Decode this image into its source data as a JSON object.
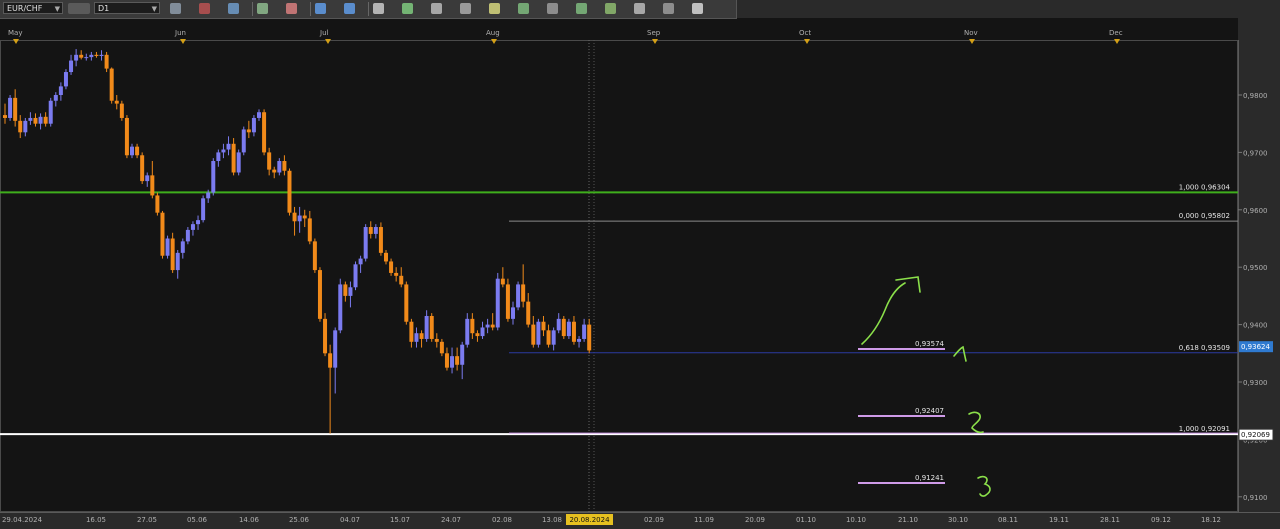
{
  "toolbar": {
    "symbol": "EUR/CHF",
    "timeframe": "D1",
    "tools": [
      "chart-type-icon",
      "crosshair-icon",
      "indicators-icon",
      "bars-icon",
      "candles-icon",
      "zoom-in-icon",
      "zoom-out-icon",
      "cursor-icon",
      "line-icon",
      "text-icon",
      "shapes-icon",
      "pencil-icon",
      "fibonacci-icon",
      "channel-icon",
      "trend-icon",
      "pitchfork-icon",
      "circle-icon",
      "arrow-icon",
      "eraser-icon"
    ]
  },
  "colors": {
    "background": "#141414",
    "bull_candle": "#7b7bf0",
    "bear_candle": "#f18a1a",
    "green_level": "#3fae1c",
    "fib_line": "#8a8a8a",
    "white_level": "#ffffff",
    "navy_level": "#2b3aa0",
    "pink_level": "#cf9be8",
    "annotation": "#8be04a",
    "price_tag_bg": "#2f7ad0"
  },
  "chart_data": {
    "type": "candlestick",
    "symbol": "EUR/CHF",
    "timeframe": "D1",
    "ylim": [
      0.91,
      0.987
    ],
    "yticks": [
      "0,9800",
      "0,9700",
      "0,9600",
      "0,9500",
      "0,9400",
      "0,9300",
      "0,9200",
      "0,9100"
    ],
    "months": [
      "May",
      "Jun",
      "Jul",
      "Aug",
      "Sep",
      "Oct",
      "Nov",
      "Dec"
    ],
    "xticks": [
      "29.04.2024",
      "16.05",
      "27.05",
      "05.06",
      "14.06",
      "25.06",
      "04.07",
      "15.07",
      "24.07",
      "02.08",
      "13.08",
      "20.08.2024",
      "02.09",
      "11.09",
      "20.09",
      "01.10",
      "10.10",
      "21.10",
      "30.10",
      "08.11",
      "19.11",
      "28.11",
      "09.12",
      "18.12"
    ],
    "highlighted_date": "20.08.2024",
    "current_price": "0,93624",
    "levels": [
      {
        "name": "green",
        "label": "1,000 0,96304",
        "price": 0.96304
      },
      {
        "name": "fib-zero",
        "label": "0,000 0,95802",
        "price": 0.95802
      },
      {
        "name": "fib-618",
        "label": "0,618 0,93509",
        "price": 0.93509
      },
      {
        "name": "white",
        "label": "1,000 0,92091",
        "price": 0.92091
      },
      {
        "name": "white-tag",
        "label": "0,92069",
        "price": 0.92069
      }
    ],
    "targets": [
      {
        "label": "0,93574",
        "price": 0.93574,
        "mark": "1"
      },
      {
        "label": "0,92407",
        "price": 0.92407,
        "mark": "2"
      },
      {
        "label": "0,91241",
        "price": 0.91241,
        "mark": "3"
      }
    ],
    "candles": [
      [
        0.9765,
        0.9785,
        0.975,
        0.976
      ],
      [
        0.976,
        0.98,
        0.9755,
        0.9795
      ],
      [
        0.9795,
        0.981,
        0.9745,
        0.9755
      ],
      [
        0.9755,
        0.9765,
        0.9725,
        0.9735
      ],
      [
        0.9735,
        0.976,
        0.9728,
        0.9755
      ],
      [
        0.9755,
        0.977,
        0.9748,
        0.976
      ],
      [
        0.976,
        0.9768,
        0.9745,
        0.975
      ],
      [
        0.975,
        0.9768,
        0.974,
        0.9762
      ],
      [
        0.9762,
        0.977,
        0.9745,
        0.975
      ],
      [
        0.975,
        0.9795,
        0.9745,
        0.979
      ],
      [
        0.979,
        0.9805,
        0.978,
        0.98
      ],
      [
        0.98,
        0.9822,
        0.979,
        0.9815
      ],
      [
        0.9815,
        0.9845,
        0.981,
        0.984
      ],
      [
        0.984,
        0.987,
        0.9835,
        0.986
      ],
      [
        0.986,
        0.988,
        0.985,
        0.987
      ],
      [
        0.987,
        0.9878,
        0.9862,
        0.9865
      ],
      [
        0.9865,
        0.9872,
        0.986,
        0.9866
      ],
      [
        0.9866,
        0.9875,
        0.986,
        0.987
      ],
      [
        0.987,
        0.9875,
        0.9865,
        0.9868
      ],
      [
        0.9868,
        0.9878,
        0.986,
        0.987
      ],
      [
        0.987,
        0.9875,
        0.984,
        0.9846
      ],
      [
        0.9846,
        0.9848,
        0.9785,
        0.979
      ],
      [
        0.979,
        0.98,
        0.9775,
        0.9785
      ],
      [
        0.9785,
        0.979,
        0.9755,
        0.976
      ],
      [
        0.976,
        0.9765,
        0.969,
        0.9695
      ],
      [
        0.9695,
        0.9715,
        0.969,
        0.971
      ],
      [
        0.971,
        0.9715,
        0.969,
        0.9695
      ],
      [
        0.9695,
        0.97,
        0.9645,
        0.965
      ],
      [
        0.965,
        0.9665,
        0.964,
        0.966
      ],
      [
        0.966,
        0.9685,
        0.962,
        0.9625
      ],
      [
        0.9625,
        0.963,
        0.959,
        0.9595
      ],
      [
        0.9595,
        0.9598,
        0.9515,
        0.952
      ],
      [
        0.952,
        0.9555,
        0.9515,
        0.955
      ],
      [
        0.955,
        0.956,
        0.949,
        0.9495
      ],
      [
        0.9495,
        0.953,
        0.948,
        0.9525
      ],
      [
        0.9525,
        0.955,
        0.9515,
        0.9545
      ],
      [
        0.9545,
        0.957,
        0.954,
        0.9565
      ],
      [
        0.9565,
        0.958,
        0.9555,
        0.9575
      ],
      [
        0.9575,
        0.959,
        0.9565,
        0.9582
      ],
      [
        0.9582,
        0.9625,
        0.9578,
        0.962
      ],
      [
        0.962,
        0.9635,
        0.9612,
        0.963
      ],
      [
        0.963,
        0.969,
        0.9625,
        0.9685
      ],
      [
        0.9685,
        0.9705,
        0.9675,
        0.97
      ],
      [
        0.97,
        0.9715,
        0.969,
        0.9705
      ],
      [
        0.9705,
        0.9728,
        0.9695,
        0.9715
      ],
      [
        0.9715,
        0.9725,
        0.966,
        0.9665
      ],
      [
        0.9665,
        0.9705,
        0.966,
        0.97
      ],
      [
        0.97,
        0.9745,
        0.9695,
        0.974
      ],
      [
        0.974,
        0.9755,
        0.9725,
        0.9735
      ],
      [
        0.9735,
        0.9765,
        0.9728,
        0.976
      ],
      [
        0.976,
        0.9775,
        0.9755,
        0.977
      ],
      [
        0.977,
        0.9775,
        0.9695,
        0.97
      ],
      [
        0.97,
        0.9708,
        0.966,
        0.967
      ],
      [
        0.967,
        0.9675,
        0.9655,
        0.9665
      ],
      [
        0.9665,
        0.969,
        0.966,
        0.9685
      ],
      [
        0.9685,
        0.9695,
        0.966,
        0.9668
      ],
      [
        0.9668,
        0.9672,
        0.959,
        0.9595
      ],
      [
        0.9595,
        0.9605,
        0.9555,
        0.958
      ],
      [
        0.958,
        0.9605,
        0.956,
        0.959
      ],
      [
        0.959,
        0.96,
        0.957,
        0.9585
      ],
      [
        0.9585,
        0.9598,
        0.954,
        0.9545
      ],
      [
        0.9545,
        0.955,
        0.949,
        0.9495
      ],
      [
        0.9495,
        0.95,
        0.9405,
        0.941
      ],
      [
        0.941,
        0.942,
        0.9345,
        0.935
      ],
      [
        0.935,
        0.9365,
        0.921,
        0.9325
      ],
      [
        0.9325,
        0.9395,
        0.928,
        0.939
      ],
      [
        0.939,
        0.948,
        0.9385,
        0.947
      ],
      [
        0.947,
        0.9475,
        0.944,
        0.945
      ],
      [
        0.945,
        0.9475,
        0.943,
        0.9465
      ],
      [
        0.9465,
        0.951,
        0.946,
        0.9505
      ],
      [
        0.9505,
        0.952,
        0.949,
        0.9515
      ],
      [
        0.9515,
        0.9575,
        0.951,
        0.957
      ],
      [
        0.957,
        0.958,
        0.955,
        0.9558
      ],
      [
        0.9558,
        0.9575,
        0.955,
        0.957
      ],
      [
        0.957,
        0.9578,
        0.952,
        0.9525
      ],
      [
        0.9525,
        0.953,
        0.9505,
        0.951
      ],
      [
        0.951,
        0.9515,
        0.9485,
        0.949
      ],
      [
        0.949,
        0.95,
        0.9475,
        0.9485
      ],
      [
        0.9485,
        0.95,
        0.9465,
        0.947
      ],
      [
        0.947,
        0.9475,
        0.94,
        0.9405
      ],
      [
        0.9405,
        0.941,
        0.936,
        0.937
      ],
      [
        0.937,
        0.9395,
        0.936,
        0.9385
      ],
      [
        0.9385,
        0.939,
        0.936,
        0.9375
      ],
      [
        0.9375,
        0.9425,
        0.937,
        0.9415
      ],
      [
        0.9415,
        0.942,
        0.937,
        0.9375
      ],
      [
        0.9375,
        0.9385,
        0.936,
        0.937
      ],
      [
        0.937,
        0.9375,
        0.9345,
        0.935
      ],
      [
        0.935,
        0.936,
        0.932,
        0.9325
      ],
      [
        0.9325,
        0.936,
        0.9315,
        0.9345
      ],
      [
        0.9345,
        0.936,
        0.932,
        0.933
      ],
      [
        0.933,
        0.937,
        0.9305,
        0.9365
      ],
      [
        0.9365,
        0.942,
        0.936,
        0.941
      ],
      [
        0.941,
        0.942,
        0.9375,
        0.9385
      ],
      [
        0.9385,
        0.939,
        0.937,
        0.938
      ],
      [
        0.938,
        0.9405,
        0.9375,
        0.9395
      ],
      [
        0.9395,
        0.941,
        0.9385,
        0.94
      ],
      [
        0.94,
        0.942,
        0.939,
        0.9395
      ],
      [
        0.9395,
        0.949,
        0.939,
        0.948
      ],
      [
        0.948,
        0.95,
        0.9465,
        0.947
      ],
      [
        0.947,
        0.948,
        0.9405,
        0.941
      ],
      [
        0.941,
        0.944,
        0.94,
        0.943
      ],
      [
        0.943,
        0.9475,
        0.9425,
        0.947
      ],
      [
        0.947,
        0.9505,
        0.943,
        0.944
      ],
      [
        0.944,
        0.9455,
        0.9395,
        0.94
      ],
      [
        0.94,
        0.9415,
        0.936,
        0.9365
      ],
      [
        0.9365,
        0.941,
        0.936,
        0.9405
      ],
      [
        0.9405,
        0.9415,
        0.938,
        0.939
      ],
      [
        0.939,
        0.94,
        0.936,
        0.9365
      ],
      [
        0.9365,
        0.9395,
        0.9355,
        0.939
      ],
      [
        0.939,
        0.942,
        0.9385,
        0.941
      ],
      [
        0.941,
        0.9415,
        0.9375,
        0.938
      ],
      [
        0.938,
        0.941,
        0.9375,
        0.9405
      ],
      [
        0.9405,
        0.9415,
        0.9365,
        0.937
      ],
      [
        0.937,
        0.938,
        0.936,
        0.9375
      ],
      [
        0.9375,
        0.941,
        0.937,
        0.94
      ],
      [
        0.94,
        0.941,
        0.935,
        0.9355
      ]
    ]
  }
}
